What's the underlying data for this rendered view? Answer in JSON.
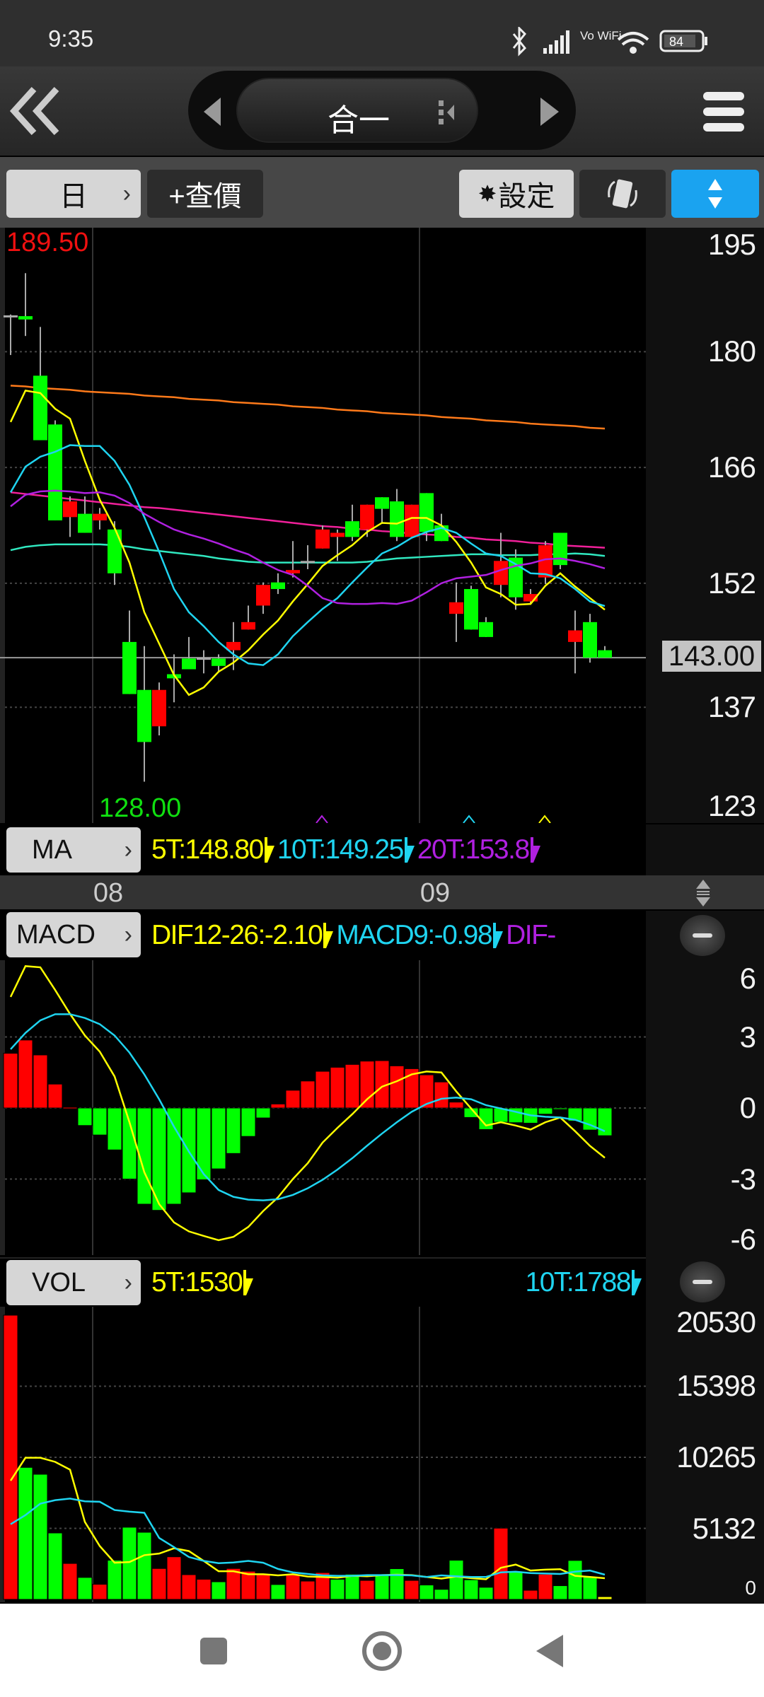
{
  "status": {
    "time": "9:35",
    "battery": "84",
    "wifi_label": "Vo WiFi"
  },
  "header": {
    "title": "合一"
  },
  "toolbar": {
    "period": "日",
    "query": "+查價",
    "settings": "設定"
  },
  "main": {
    "high_label": "189.50",
    "low_label": "128.00",
    "current_price": "143.00",
    "price_axis": [
      "195",
      "180",
      "166",
      "152",
      "137",
      "123"
    ]
  },
  "ma_legend": {
    "button": "MA",
    "items": [
      {
        "label": "5T:148.80",
        "color": "#ffff00"
      },
      {
        "label": "10T:149.25",
        "color": "#1fd4f0"
      },
      {
        "label": "20T:153.8",
        "color": "#b020e0"
      }
    ]
  },
  "date_axis": [
    "08",
    "09"
  ],
  "macd_legend": {
    "button": "MACD",
    "items": [
      {
        "label": "DIF12-26:-2.10",
        "color": "#ffff00"
      },
      {
        "label": "MACD9:-0.98",
        "color": "#1fd4f0"
      },
      {
        "label": "DIF-",
        "color": "#b020e0"
      }
    ],
    "axis": [
      "6",
      "3",
      "0",
      "-3",
      "-6"
    ]
  },
  "vol_legend": {
    "button": "VOL",
    "items": [
      {
        "label": "5T:1530",
        "color": "#ffff00"
      },
      {
        "label": "10T:1788",
        "color": "#1fd4f0"
      }
    ],
    "axis": [
      "20530",
      "15398",
      "10265",
      "5132",
      "0"
    ]
  },
  "colors": {
    "up": "#ff0000",
    "down": "#00ff00",
    "flat": "#aaaaaa",
    "accent": "#1aa3f0"
  },
  "chart_data": [
    {
      "type": "candlestick",
      "title": "合一 日K",
      "ylim": [
        123,
        195
      ],
      "x_ticks": [
        "08",
        "09"
      ],
      "ohlc": [
        [
          184.4,
          184.5,
          179.6,
          184.4
        ],
        [
          184.3,
          189.5,
          181.9,
          183.9
        ],
        [
          177.1,
          183.0,
          169.3,
          169.3
        ],
        [
          171.2,
          171.7,
          159.6,
          159.6
        ],
        [
          160.0,
          162.5,
          157.6,
          161.9
        ],
        [
          160.4,
          162.5,
          158.1,
          158.1
        ],
        [
          159.6,
          161.1,
          158.5,
          160.4
        ],
        [
          158.5,
          159.5,
          151.8,
          153.2
        ],
        [
          144.9,
          148.7,
          138.6,
          138.6
        ],
        [
          139.1,
          144.4,
          128.0,
          132.8
        ],
        [
          134.7,
          140.0,
          133.6,
          139.1
        ],
        [
          141.0,
          143.4,
          137.6,
          140.5
        ],
        [
          142.9,
          145.5,
          141.6,
          141.6
        ],
        [
          143.0,
          143.9,
          141.1,
          143.0
        ],
        [
          142.9,
          143.4,
          141.3,
          142.0
        ],
        [
          143.9,
          147.3,
          141.5,
          144.9
        ],
        [
          146.4,
          149.3,
          146.4,
          147.3
        ],
        [
          149.3,
          152.1,
          148.3,
          151.8
        ],
        [
          152.1,
          153.2,
          150.7,
          151.3
        ],
        [
          153.2,
          157.1,
          152.7,
          153.6
        ],
        [
          154.7,
          156.6,
          153.7,
          154.7
        ],
        [
          156.2,
          159.0,
          156.2,
          158.5
        ],
        [
          157.6,
          158.5,
          154.7,
          158.1
        ],
        [
          159.5,
          161.5,
          157.1,
          157.6
        ],
        [
          158.5,
          161.5,
          157.6,
          161.5
        ],
        [
          162.4,
          162.4,
          159.2,
          161.0
        ],
        [
          161.9,
          163.4,
          157.1,
          157.6
        ],
        [
          157.6,
          161.5,
          157.6,
          161.5
        ],
        [
          162.9,
          162.9,
          157.1,
          158.2
        ],
        [
          159.0,
          160.4,
          157.1,
          157.1
        ],
        [
          148.3,
          152.1,
          144.9,
          149.7
        ],
        [
          151.3,
          151.7,
          146.4,
          146.4
        ],
        [
          147.3,
          147.9,
          145.5,
          145.5
        ],
        [
          151.8,
          158.1,
          150.3,
          154.7
        ],
        [
          155.1,
          156.1,
          148.8,
          150.3
        ],
        [
          149.8,
          151.3,
          149.4,
          150.7
        ],
        [
          152.7,
          157.1,
          151.9,
          156.6
        ],
        [
          158.1,
          158.1,
          153.7,
          154.2
        ],
        [
          144.9,
          148.7,
          141.1,
          146.3
        ],
        [
          147.3,
          148.3,
          142.4,
          143.0
        ],
        [
          143.9,
          144.4,
          143.0,
          143.0
        ]
      ],
      "series": [
        {
          "name": "MA5",
          "color": "#ffff00",
          "values": [
            171.5,
            175.3,
            175.0,
            173.1,
            171.9,
            166.8,
            162.1,
            158.7,
            154.5,
            148.5,
            144.7,
            140.9,
            138.5,
            139.4,
            141.3,
            142.4,
            143.9,
            145.8,
            147.5,
            149.8,
            151.9,
            154.1,
            155.4,
            156.6,
            158.2,
            159.3,
            159.2,
            159.9,
            159.9,
            159.0,
            157.0,
            154.5,
            151.5,
            150.7,
            149.4,
            149.5,
            151.7,
            153.2,
            151.6,
            150.2,
            148.8
          ]
        },
        {
          "name": "MA10",
          "color": "#1fd4f0",
          "values": [
            163.0,
            166.1,
            167.3,
            167.9,
            168.7,
            168.6,
            168.6,
            166.8,
            163.9,
            160.0,
            155.8,
            151.3,
            148.5,
            146.8,
            144.9,
            143.4,
            142.3,
            142.1,
            143.4,
            145.6,
            147.3,
            148.9,
            150.2,
            152.1,
            153.9,
            155.6,
            156.4,
            157.5,
            158.2,
            158.7,
            158.1,
            156.8,
            155.6,
            155.3,
            154.3,
            153.2,
            153.1,
            152.6,
            151.3,
            149.8,
            149.25
          ]
        },
        {
          "name": "MA20",
          "color": "#b020e0",
          "values": [
            161.3,
            162.7,
            163.1,
            163.2,
            163.1,
            162.9,
            163.0,
            162.6,
            161.7,
            160.4,
            159.4,
            158.5,
            157.9,
            157.4,
            156.8,
            156.1,
            155.5,
            154.5,
            153.6,
            153.0,
            151.7,
            150.2,
            149.6,
            149.5,
            149.5,
            149.6,
            149.5,
            149.9,
            150.9,
            152.0,
            152.6,
            152.8,
            153.0,
            153.6,
            154.1,
            154.4,
            154.9,
            155.0,
            154.7,
            154.3,
            153.8
          ]
        },
        {
          "name": "MA-magenta",
          "color": "#f0209a",
          "values": [
            163.0,
            162.8,
            162.6,
            162.4,
            162.2,
            162.0,
            161.8,
            161.6,
            161.4,
            161.2,
            161.1,
            160.9,
            160.7,
            160.5,
            160.3,
            160.1,
            159.9,
            159.7,
            159.5,
            159.3,
            159.1,
            158.9,
            158.8,
            158.6,
            158.5,
            158.3,
            158.2,
            158.0,
            157.9,
            157.8,
            157.6,
            157.5,
            157.3,
            157.2,
            157.1,
            156.9,
            156.8,
            156.6,
            156.5,
            156.4,
            156.3
          ]
        },
        {
          "name": "MA-teal",
          "color": "#30e8c0",
          "values": [
            156.0,
            156.4,
            156.6,
            156.7,
            156.7,
            156.7,
            156.7,
            156.6,
            156.4,
            156.1,
            155.9,
            155.7,
            155.5,
            155.3,
            155.0,
            154.8,
            154.6,
            154.5,
            154.5,
            154.5,
            154.5,
            154.5,
            154.5,
            154.5,
            154.6,
            154.8,
            155.0,
            155.1,
            155.2,
            155.3,
            155.4,
            155.5,
            155.5,
            155.4,
            155.4,
            155.4,
            155.5,
            155.5,
            155.6,
            155.5,
            155.3
          ]
        },
        {
          "name": "MA-orange",
          "color": "#ff7a1a",
          "values": [
            175.9,
            175.8,
            175.6,
            175.5,
            175.4,
            175.2,
            175.1,
            175.0,
            174.9,
            174.7,
            174.6,
            174.5,
            174.3,
            174.2,
            174.1,
            173.9,
            173.8,
            173.7,
            173.6,
            173.4,
            173.3,
            173.2,
            173.0,
            172.9,
            172.8,
            172.6,
            172.5,
            172.4,
            172.3,
            172.1,
            172.0,
            171.9,
            171.7,
            171.6,
            171.5,
            171.3,
            171.2,
            171.1,
            171.0,
            170.8,
            170.7
          ]
        }
      ]
    },
    {
      "type": "bar+line",
      "title": "MACD",
      "ylim": [
        -6,
        6
      ],
      "histogram": [
        2.31,
        2.87,
        2.24,
        1.01,
        0.03,
        -0.74,
        -1.14,
        -1.77,
        -3.0,
        -4.06,
        -4.32,
        -4.06,
        -3.58,
        -3.03,
        -2.57,
        -1.92,
        -1.2,
        -0.42,
        0.17,
        0.75,
        1.14,
        1.55,
        1.72,
        1.84,
        1.98,
        2.0,
        1.78,
        1.66,
        1.4,
        1.1,
        0.25,
        -0.4,
        -0.91,
        -0.6,
        -0.62,
        -0.64,
        -0.26,
        -0.04,
        -0.55,
        -0.93,
        -1.17
      ],
      "series": [
        {
          "name": "DIF12-26",
          "color": "#ffff00",
          "values": [
            4.69,
            5.99,
            5.94,
            4.98,
            3.97,
            3.06,
            2.38,
            1.33,
            -0.6,
            -2.71,
            -4.06,
            -4.83,
            -5.21,
            -5.4,
            -5.58,
            -5.44,
            -5.02,
            -4.35,
            -3.77,
            -3.0,
            -2.33,
            -1.46,
            -0.84,
            -0.26,
            0.37,
            0.9,
            1.13,
            1.42,
            1.54,
            1.5,
            0.7,
            -0.02,
            -0.74,
            -0.6,
            -0.74,
            -0.91,
            -0.6,
            -0.4,
            -0.98,
            -1.6,
            -2.1
          ]
        },
        {
          "name": "MACD9",
          "color": "#1fd4f0",
          "values": [
            2.48,
            3.17,
            3.7,
            3.96,
            3.96,
            3.8,
            3.54,
            3.06,
            2.34,
            1.42,
            0.37,
            -0.79,
            -1.84,
            -2.79,
            -3.46,
            -3.75,
            -3.87,
            -3.9,
            -3.85,
            -3.67,
            -3.39,
            -3.03,
            -2.6,
            -2.12,
            -1.59,
            -1.08,
            -0.6,
            -0.16,
            0.17,
            0.39,
            0.44,
            0.37,
            0.12,
            -0.02,
            -0.16,
            -0.31,
            -0.37,
            -0.4,
            -0.5,
            -0.71,
            -0.98
          ]
        }
      ]
    },
    {
      "type": "bar+line",
      "title": "VOL",
      "ylim": [
        0,
        20530
      ],
      "values": [
        20530,
        9537,
        9040,
        4801,
        2599,
        1589,
        1093,
        2831,
        5215,
        4851,
        2235,
        3080,
        1788,
        1457,
        1275,
        2235,
        2037,
        1788,
        1076,
        1788,
        1325,
        1937,
        1457,
        1821,
        1374,
        1821,
        2219,
        1374,
        1043,
        728,
        2831,
        1424,
        877,
        5149,
        2003,
        662,
        1821,
        993,
        2815,
        1623,
        199
      ],
      "directions": [
        "up",
        "down",
        "down",
        "down",
        "up",
        "down",
        "up",
        "down",
        "down",
        "down",
        "up",
        "up",
        "up",
        "up",
        "down",
        "up",
        "up",
        "up",
        "down",
        "up",
        "up",
        "up",
        "down",
        "down",
        "up",
        "down",
        "down",
        "up",
        "down",
        "down",
        "down",
        "down",
        "down",
        "up",
        "down",
        "up",
        "up",
        "down",
        "down",
        "down",
        "flat"
      ],
      "series": [
        {
          "name": "5T",
          "color": "#ffff00",
          "values": [
            8576,
            10232,
            10232,
            9934,
            9371,
            5595,
            3857,
            2649,
            2699,
            3196,
            3311,
            3692,
            3494,
            2781,
            2036,
            2036,
            1821,
            1821,
            1738,
            1821,
            1656,
            1622,
            1573,
            1705,
            1672,
            1755,
            1788,
            1755,
            1622,
            1507,
            1656,
            1540,
            1457,
            2285,
            2516,
            2086,
            2152,
            2185,
            1705,
            1622,
            1530
          ]
        },
        {
          "name": "10T",
          "color": "#1fd4f0",
          "values": [
            5430,
            6092,
            6920,
            7168,
            7284,
            7085,
            7052,
            6456,
            6340,
            6258,
            4437,
            3775,
            3063,
            2781,
            2616,
            2666,
            2781,
            2649,
            2202,
            1954,
            1838,
            1738,
            1705,
            1705,
            1755,
            1755,
            1755,
            1738,
            1622,
            1738,
            1672,
            1622,
            1622,
            1954,
            2003,
            1904,
            1871,
            1838,
            2003,
            2086,
            1788
          ]
        }
      ]
    }
  ]
}
